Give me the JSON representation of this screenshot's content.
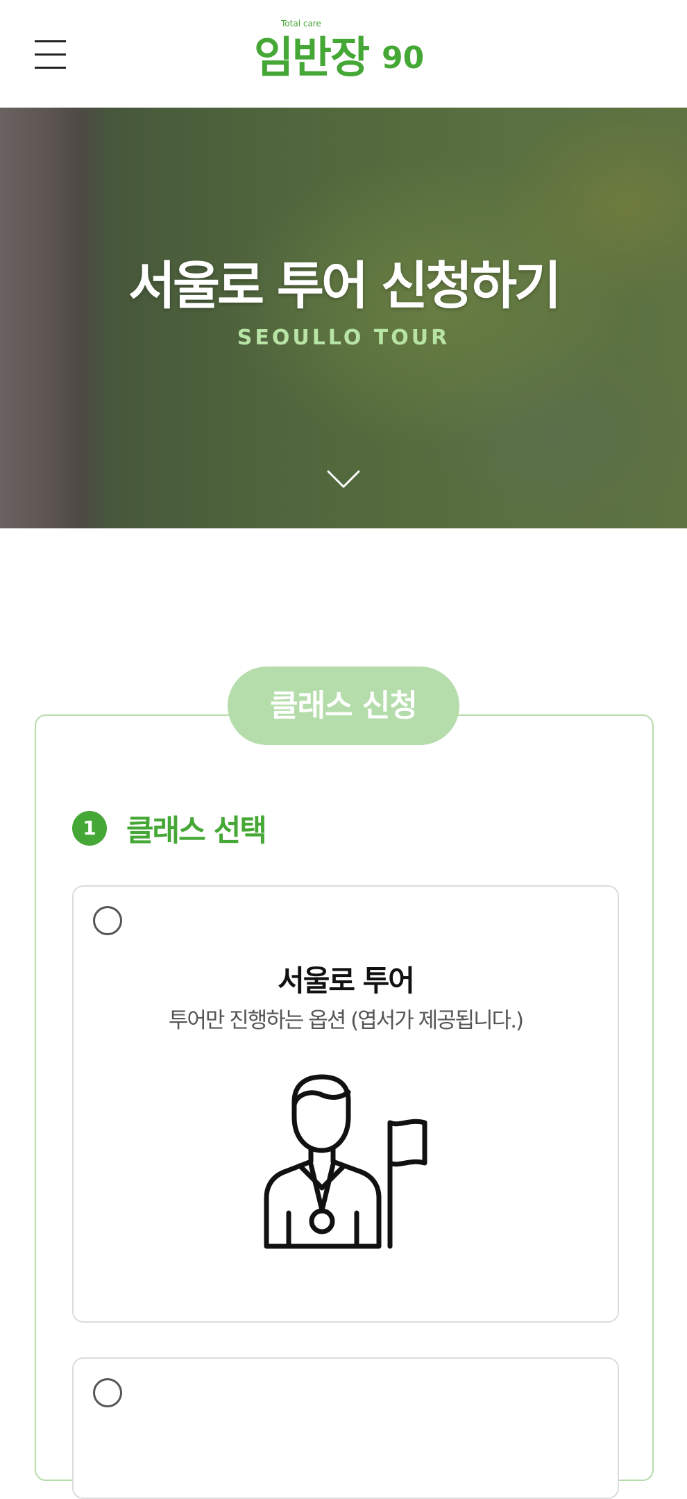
{
  "header": {
    "menu_icon": "hamburger-menu-icon",
    "logo": {
      "small_text": "Total care",
      "text": "임반장",
      "suffix": "90",
      "color": "#45a735"
    }
  },
  "hero": {
    "title": "서울로 투어 신청하기",
    "subtitle": "SEOULLO TOUR",
    "scroll_icon": "chevron-down-icon"
  },
  "apply": {
    "pill_label": "클래스 신청",
    "pill_color": "#b5dcab",
    "step": {
      "number": "1",
      "title": "클래스 선택",
      "accent": "#45a735"
    },
    "options": [
      {
        "title": "서울로 투어",
        "description": "투어만 진행하는 옵션 (엽서가 제공됩니다.)",
        "icon": "tour-guide-with-flag-icon",
        "selected": false
      },
      {
        "selected": false
      }
    ]
  }
}
